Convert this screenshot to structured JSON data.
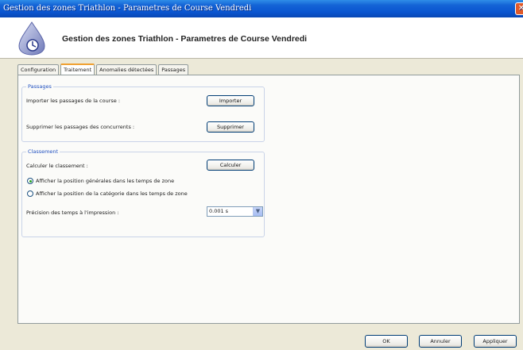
{
  "window": {
    "title": "Gestion des zones Triathlon - Parametres de Course Vendredi",
    "close_glyph": "✕"
  },
  "header": {
    "title": "Gestion des zones Triathlon - Parametres de Course Vendredi",
    "logo_icon": "app-logo-icon"
  },
  "tabs": [
    {
      "label": "Configuration",
      "active": false
    },
    {
      "label": "Traitement",
      "active": true
    },
    {
      "label": "Anomalies détectées",
      "active": false
    },
    {
      "label": "Passages",
      "active": false
    }
  ],
  "passages": {
    "legend": "Passages",
    "import_label": "Importer les passages de la course :",
    "import_button": "Importer",
    "delete_label": "Supprimer les passages des concurrents :",
    "delete_button": "Supprimer"
  },
  "classement": {
    "legend": "Classement",
    "calc_label": "Calculer le classement :",
    "calc_button": "Calculer",
    "radio_general": "Afficher la position générales dans les temps de zone",
    "radio_category": "Afficher la position de la catégorie dans les temps de zone",
    "radio_selected": "general",
    "precision_label": "Précision des temps à l'impression :",
    "precision_value": "0.001 s",
    "dropdown_glyph": "▼"
  },
  "footer": {
    "ok": "OK",
    "cancel": "Annuler",
    "apply": "Appliquer"
  },
  "colors": {
    "titlebar": "#0a55d0",
    "accent_tab": "#f0a030",
    "legend": "#2050c0"
  }
}
